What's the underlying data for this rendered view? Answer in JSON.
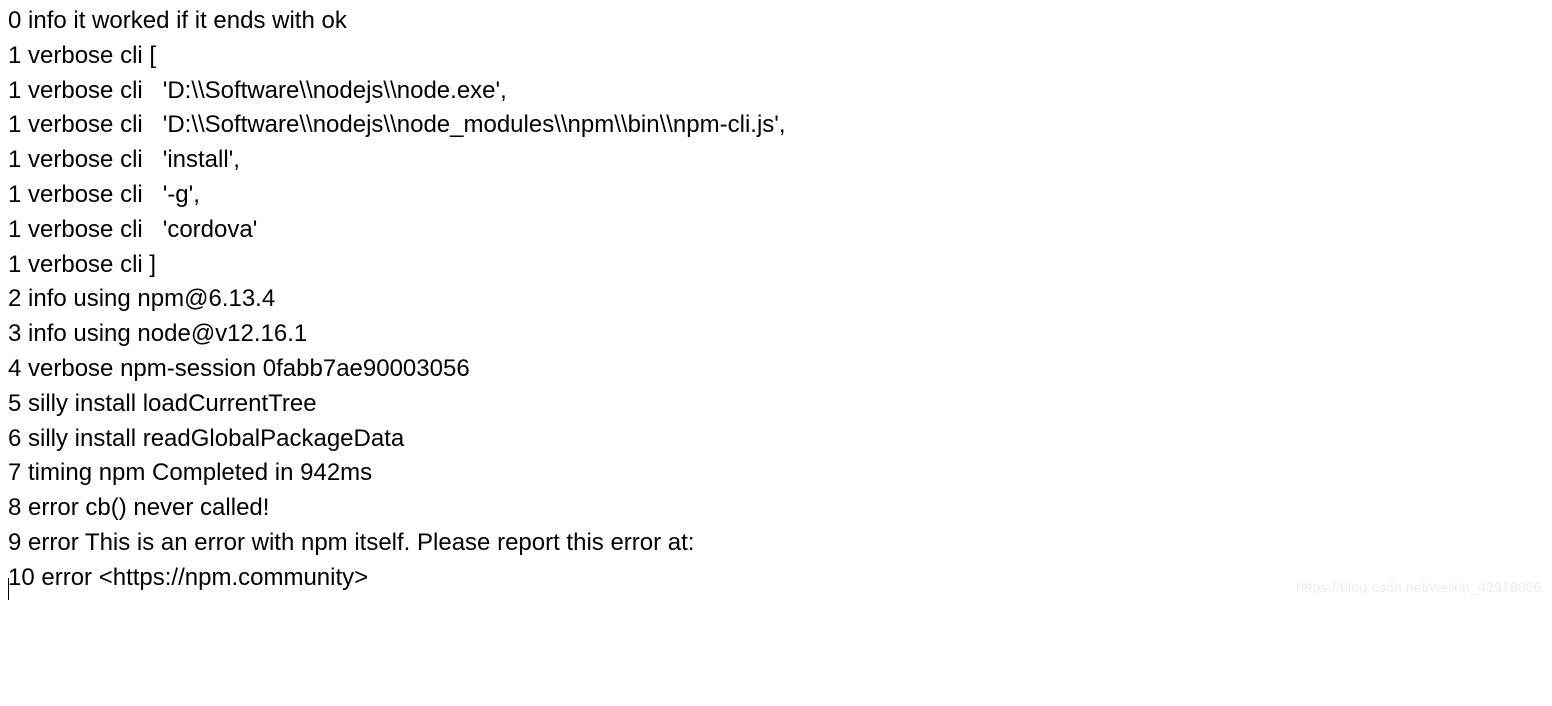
{
  "log": {
    "lines": [
      "0 info it worked if it ends with ok",
      "1 verbose cli [",
      "1 verbose cli   'D:\\\\Software\\\\nodejs\\\\node.exe',",
      "1 verbose cli   'D:\\\\Software\\\\nodejs\\\\node_modules\\\\npm\\\\bin\\\\npm-cli.js',",
      "1 verbose cli   'install',",
      "1 verbose cli   '-g',",
      "1 verbose cli   'cordova'",
      "1 verbose cli ]",
      "2 info using npm@6.13.4",
      "3 info using node@v12.16.1",
      "4 verbose npm-session 0fabb7ae90003056",
      "5 silly install loadCurrentTree",
      "6 silly install readGlobalPackageData",
      "7 timing npm Completed in 942ms",
      "8 error cb() never called!",
      "9 error This is an error with npm itself. Please report this error at:",
      "10 error <https://npm.community>"
    ]
  },
  "watermark": "https://blog.csdn.net/weixin_43978056"
}
